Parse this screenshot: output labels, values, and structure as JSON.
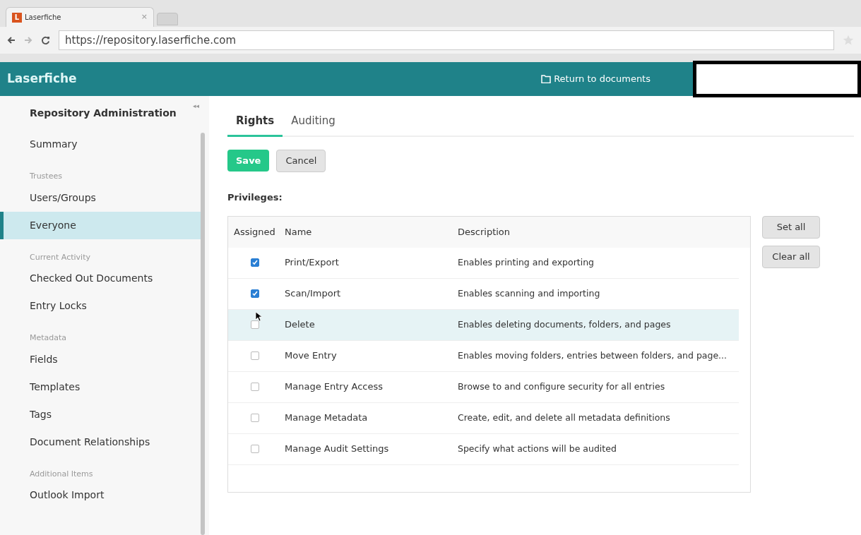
{
  "browser": {
    "tab_title": "Laserfiche",
    "tab_logo": "L",
    "close": "×",
    "url": "https://repository.laserfiche.com"
  },
  "header": {
    "brand": "Laserfiche",
    "return_link": "Return to documents"
  },
  "sidebar": {
    "title": "Repository Administration",
    "collapse": "◂◂",
    "items": [
      {
        "kind": "item",
        "label": "Summary",
        "selected": false
      },
      {
        "kind": "header",
        "label": "Trustees"
      },
      {
        "kind": "item",
        "label": "Users/Groups",
        "selected": false
      },
      {
        "kind": "item",
        "label": "Everyone",
        "selected": true
      },
      {
        "kind": "header",
        "label": "Current Activity"
      },
      {
        "kind": "item",
        "label": "Checked Out Documents",
        "selected": false
      },
      {
        "kind": "item",
        "label": "Entry Locks",
        "selected": false
      },
      {
        "kind": "header",
        "label": "Metadata"
      },
      {
        "kind": "item",
        "label": "Fields",
        "selected": false
      },
      {
        "kind": "item",
        "label": "Templates",
        "selected": false
      },
      {
        "kind": "item",
        "label": "Tags",
        "selected": false
      },
      {
        "kind": "item",
        "label": "Document Relationships",
        "selected": false
      },
      {
        "kind": "header",
        "label": "Additional Items"
      },
      {
        "kind": "item",
        "label": "Outlook Import",
        "selected": false
      }
    ]
  },
  "tabs": [
    {
      "label": "Rights",
      "selected": true
    },
    {
      "label": "Auditing",
      "selected": false
    }
  ],
  "actions": {
    "save": "Save",
    "cancel": "Cancel"
  },
  "privileges": {
    "label": "Privileges:",
    "columns": [
      "Assigned",
      "Name",
      "Description"
    ],
    "rows": [
      {
        "name": "Print/Export",
        "description": "Enables printing and exporting",
        "checked": true,
        "highlighted": false
      },
      {
        "name": "Scan/Import",
        "description": "Enables scanning and importing",
        "checked": true,
        "highlighted": false
      },
      {
        "name": "Delete",
        "description": "Enables deleting documents, folders, and pages",
        "checked": false,
        "highlighted": true
      },
      {
        "name": "Move Entry",
        "description": "Enables moving folders, entries between folders, and page...",
        "checked": false,
        "highlighted": false
      },
      {
        "name": "Manage Entry Access",
        "description": "Browse to and configure security for all entries",
        "checked": false,
        "highlighted": false
      },
      {
        "name": "Manage Metadata",
        "description": "Create, edit, and delete all metadata definitions",
        "checked": false,
        "highlighted": false
      },
      {
        "name": "Manage Audit Settings",
        "description": "Specify what actions will be audited",
        "checked": false,
        "highlighted": false
      }
    ],
    "set_all": "Set all",
    "clear_all": "Clear all"
  }
}
